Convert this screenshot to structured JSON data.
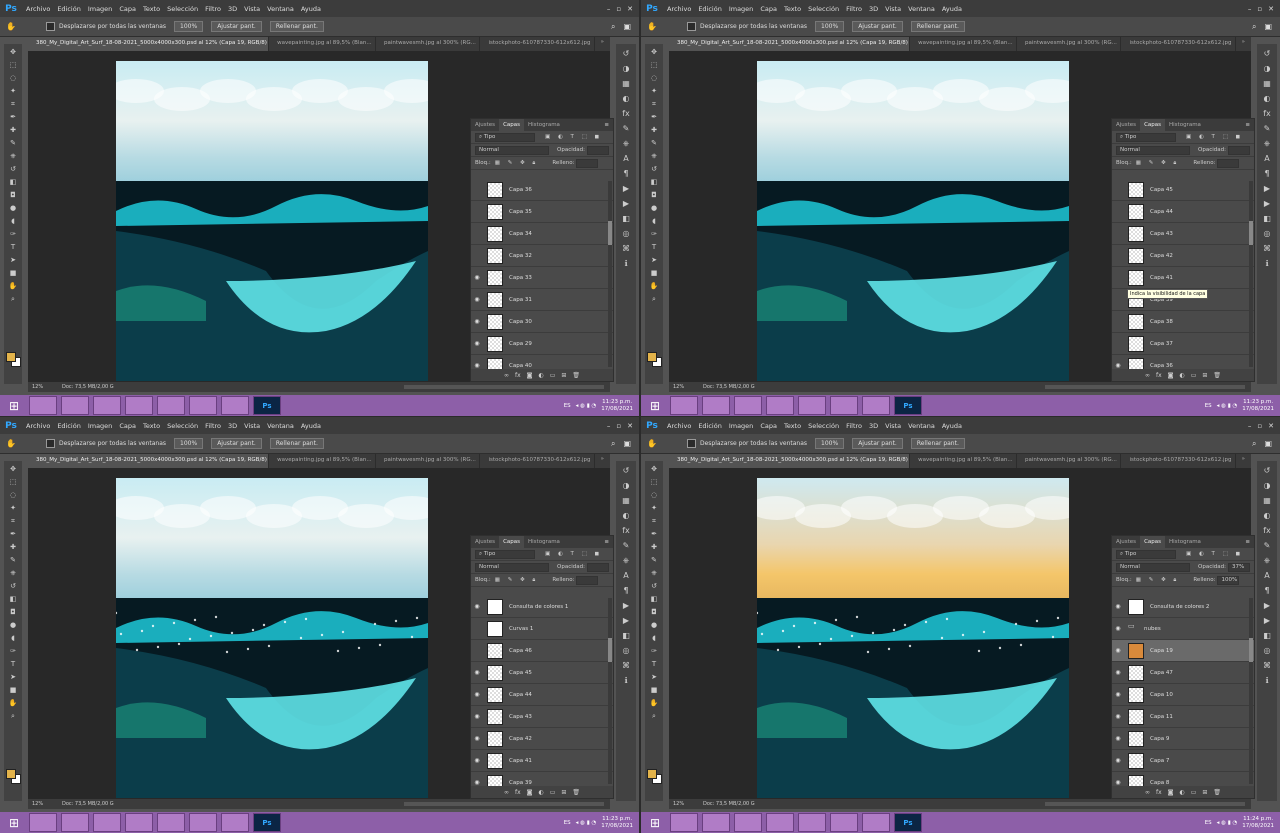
{
  "menu": {
    "logo": "Ps",
    "items": [
      "Archivo",
      "Edición",
      "Imagen",
      "Capa",
      "Texto",
      "Selección",
      "Filtro",
      "3D",
      "Vista",
      "Ventana",
      "Ayuda"
    ]
  },
  "options": {
    "scroll_all_label": "Desplazarse por todas las ventanas",
    "zoom_value": "100%",
    "fit_label": "Ajustar pant.",
    "fill_label": "Rellenar pant."
  },
  "tabs": [
    "380_My_Digital_Art_Surf_18-08-2021_5000x4000x300.psd al 12% (Capa 19, RGB/8) *",
    "wavepainting.jpg al 89,5% (Blan...",
    "paintwavesmh.jpg al 300% (RG...",
    "istockphoto-610787330-612x612.jpg"
  ],
  "status": {
    "zoom": "12%",
    "doc": "Doc: 73,5 MB/2,00 G"
  },
  "panel": {
    "tabs": [
      "Ajustes",
      "Capas",
      "Histograma"
    ],
    "filter": "Tipo",
    "blend": "Normal",
    "opacity_label": "Opacidad:",
    "lock_label": "Bloq.:",
    "fill_label": "Relleno:"
  },
  "quadrants": [
    {
      "layers": [
        "Capa 36",
        "Capa 35",
        "Capa 34",
        "Capa 32",
        "Capa 33",
        "Capa 31",
        "Capa 30",
        "Capa 29",
        "Capa 40"
      ],
      "visible": [
        false,
        false,
        false,
        false,
        true,
        true,
        true,
        true,
        true
      ]
    },
    {
      "layers": [
        "Capa 45",
        "Capa 44",
        "Capa 43",
        "Capa 42",
        "Capa 41",
        "Capa 39",
        "Capa 38",
        "Capa 37",
        "Capa 36"
      ],
      "visible": [
        false,
        false,
        false,
        false,
        false,
        false,
        false,
        false,
        true
      ],
      "tooltip": "Indica la visibilidad de la capa"
    },
    {
      "layers": [
        "Consulta de colores 1",
        "Curvas 1",
        "Capa 46",
        "Capa 45",
        "Capa 44",
        "Capa 43",
        "Capa 42",
        "Capa 41",
        "Capa 39"
      ],
      "visible": [
        true,
        false,
        false,
        true,
        true,
        true,
        true,
        true,
        true
      ]
    },
    {
      "layers": [
        "Consulta de colores 2",
        "nubes",
        "Capa 19",
        "Capa 47",
        "Capa 10",
        "Capa 11",
        "Capa 9",
        "Capa 7",
        "Capa 8"
      ],
      "visible": [
        true,
        true,
        true,
        true,
        true,
        true,
        true,
        true,
        true
      ],
      "opacity": "37%",
      "fill": "100%"
    }
  ],
  "taskbar": {
    "apps": [
      "Explorer",
      "Chrome",
      "Media",
      "Excel",
      "Word",
      "Calc",
      "Notepad",
      "Ps"
    ],
    "lang": "ES",
    "clocks": [
      {
        "time": "11:23 p.m.",
        "date": "17/08/2021"
      },
      {
        "time": "11:23 p.m.",
        "date": "17/08/2021"
      },
      {
        "time": "11:23 p.m.",
        "date": "17/08/2021"
      },
      {
        "time": "11:24 p.m.",
        "date": "17/08/2021"
      }
    ]
  },
  "icons": {
    "tools": [
      "move-icon",
      "marquee-icon",
      "lasso-icon",
      "wand-icon",
      "crop-icon",
      "eyedropper-icon",
      "heal-icon",
      "brush-icon",
      "stamp-icon",
      "history-brush-icon",
      "eraser-icon",
      "bucket-icon",
      "blur-icon",
      "dodge-icon",
      "pen-icon",
      "type-icon",
      "path-select-icon",
      "shape-icon",
      "hand-icon",
      "zoom-icon"
    ],
    "right": [
      "history-icon",
      "color-icon",
      "swatches-icon",
      "adjust-icon",
      "styles-icon",
      "brush-preset-icon",
      "clone-icon",
      "char-icon",
      "para-icon",
      "actions-icon",
      "play-icon",
      "layers-icon",
      "channels-icon",
      "paths-icon",
      "info-icon"
    ]
  }
}
